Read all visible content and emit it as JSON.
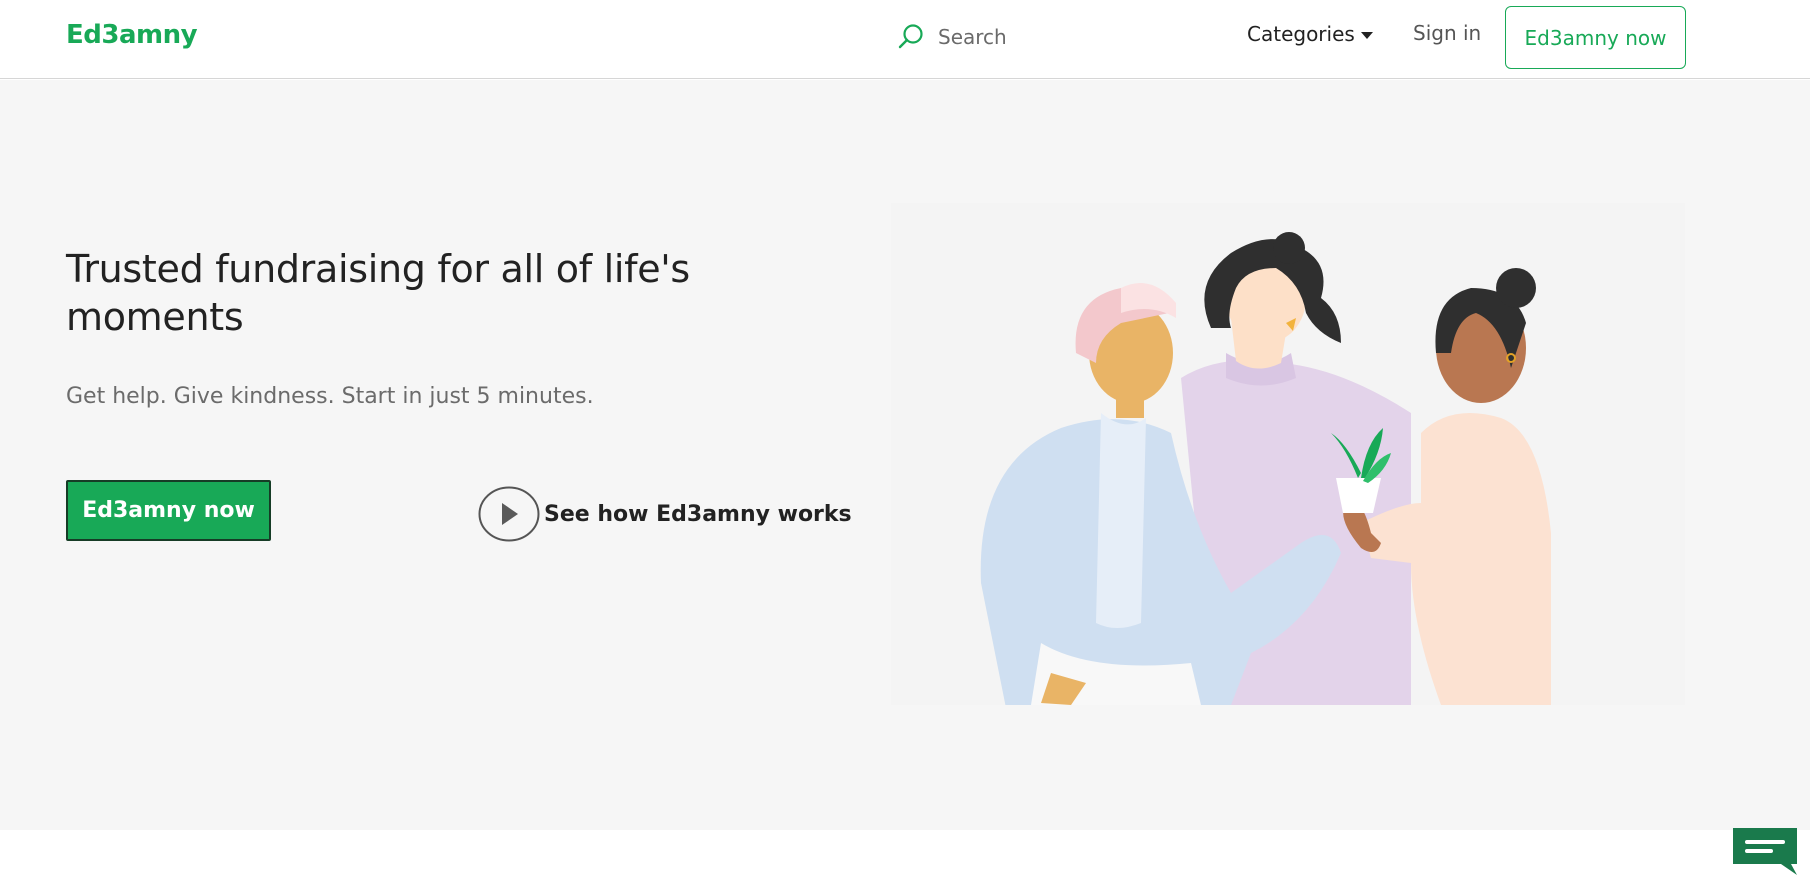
{
  "brand": {
    "name": "Ed3amny",
    "color": "#18a957"
  },
  "nav": {
    "search_icon": "search-icon",
    "search_placeholder": "Search",
    "categories_label": "Categories",
    "signin_label": "Sign in",
    "cta_label": "Ed3amny now"
  },
  "hero": {
    "title": "Trusted fundraising for all of life's moments",
    "subtitle": "Get help. Give kindness. Start in just 5 minutes.",
    "cta_label": "Ed3amny now",
    "how_label": "See how Ed3amny works",
    "how_icon": "play-icon",
    "illustration": "people-sharing-plant-illustration"
  },
  "chat": {
    "icon": "chat-icon"
  },
  "colors": {
    "accent": "#18a957",
    "hero_background": "#f6f6f6",
    "text_dark": "#222222",
    "text_muted": "#6b6b6b"
  }
}
